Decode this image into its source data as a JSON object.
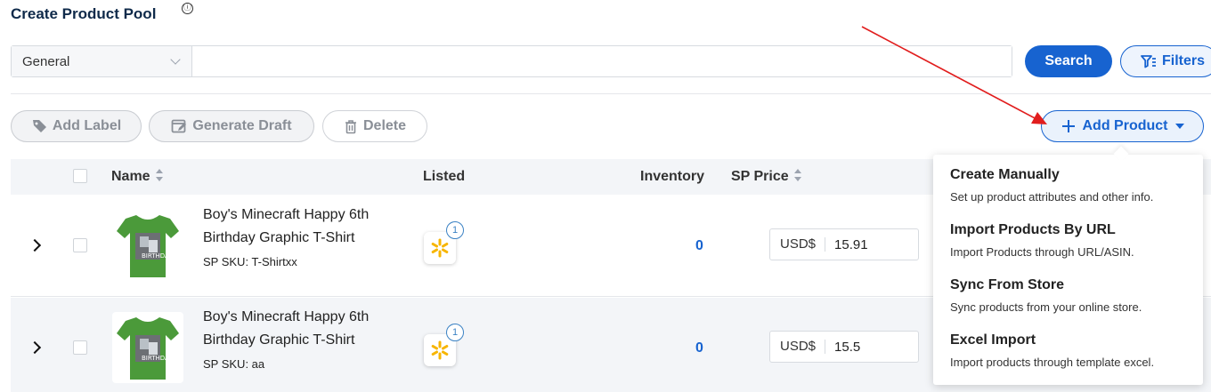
{
  "page": {
    "title": "Create Product Pool",
    "info_icon": "ⓘ"
  },
  "search": {
    "type_selected": "General",
    "value": "",
    "placeholder": "",
    "search_label": "Search",
    "filters_label": "Filters"
  },
  "actions": {
    "add_label": "Add Label",
    "generate_draft": "Generate Draft",
    "delete": "Delete",
    "add_product": "Add Product"
  },
  "table": {
    "headers": {
      "name": "Name",
      "listed": "Listed",
      "inventory": "Inventory",
      "sp_price": "SP Price"
    },
    "rows": [
      {
        "name": "Boy's Minecraft Happy 6th Birthday Graphic T-Shirt",
        "sku": "SP SKU: T-Shirtxx",
        "listed_count": "1",
        "inventory": "0",
        "currency": "USD$",
        "price": "15.91"
      },
      {
        "name": "Boy's Minecraft Happy 6th Birthday Graphic T-Shirt",
        "sku": "SP SKU: aa",
        "listed_count": "1",
        "inventory": "0",
        "currency": "USD$",
        "price": "15.5"
      }
    ]
  },
  "dropdown": {
    "items": [
      {
        "title": "Create Manually",
        "desc": "Set up product attributes and other info."
      },
      {
        "title": "Import Products By URL",
        "desc": "Import Products through URL/ASIN."
      },
      {
        "title": "Sync From Store",
        "desc": "Sync products from your online store."
      },
      {
        "title": "Excel Import",
        "desc": "Import products through template excel."
      }
    ]
  },
  "colors": {
    "primary": "#1763d0",
    "title": "#0f2a4a",
    "annotation_arrow": "#e11d1d",
    "walmart": "#f7b500"
  }
}
